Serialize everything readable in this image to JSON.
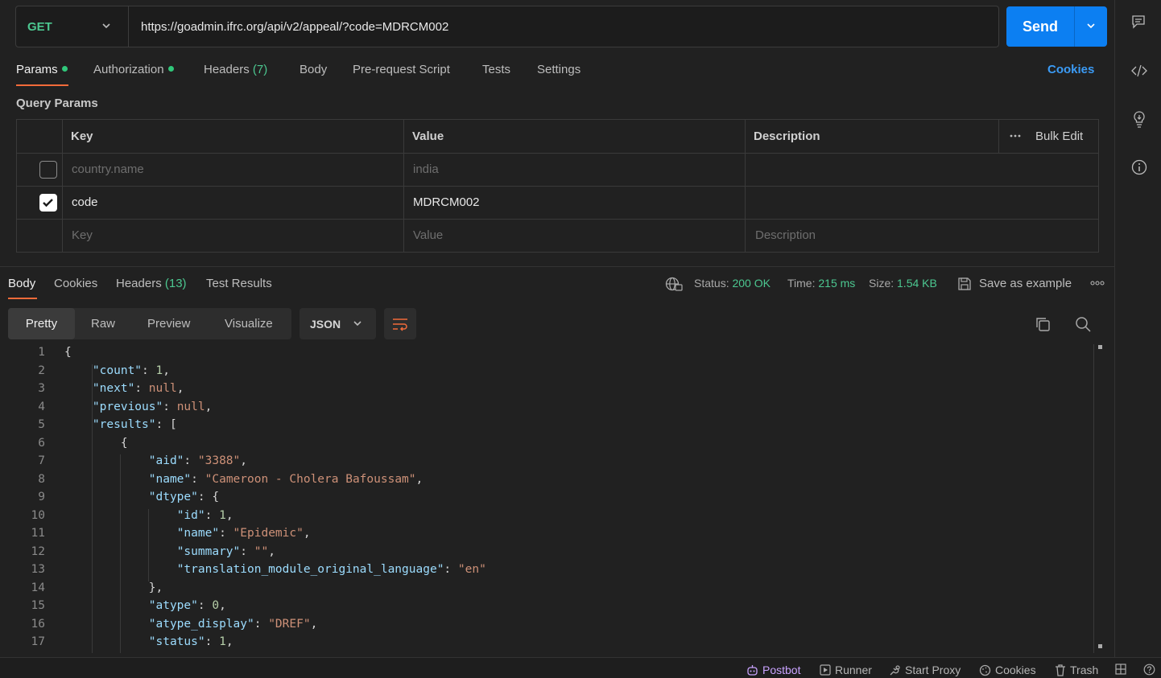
{
  "request": {
    "method": "GET",
    "url": "https://goadmin.ifrc.org/api/v2/appeal/?code=MDRCM002",
    "send_label": "Send"
  },
  "request_tabs": [
    {
      "label": "Params",
      "dot": true
    },
    {
      "label": "Authorization",
      "dot": true
    },
    {
      "label": "Headers",
      "count": "(7)"
    },
    {
      "label": "Body"
    },
    {
      "label": "Pre-request Script"
    },
    {
      "label": "Tests"
    },
    {
      "label": "Settings"
    }
  ],
  "cookies_link": "Cookies",
  "query_params": {
    "title": "Query Params",
    "headers": {
      "key": "Key",
      "value": "Value",
      "description": "Description",
      "bulk_edit": "Bulk Edit"
    },
    "rows": [
      {
        "checked": false,
        "key": "country.name",
        "value": "india",
        "description": ""
      },
      {
        "checked": true,
        "key": "code",
        "value": "MDRCM002",
        "description": ""
      }
    ],
    "placeholders": {
      "key": "Key",
      "value": "Value",
      "description": "Description"
    }
  },
  "response": {
    "tabs": [
      {
        "label": "Body"
      },
      {
        "label": "Cookies"
      },
      {
        "label": "Headers",
        "count": "(13)"
      },
      {
        "label": "Test Results"
      }
    ],
    "status_label": "Status:",
    "status_value": "200 OK",
    "time_label": "Time:",
    "time_value": "215 ms",
    "size_label": "Size:",
    "size_value": "1.54 KB",
    "save_example": "Save as example",
    "view_modes": [
      "Pretty",
      "Raw",
      "Preview",
      "Visualize"
    ],
    "format": "JSON"
  },
  "code_lines": [
    "{",
    "    \"count\": 1,",
    "    \"next\": null,",
    "    \"previous\": null,",
    "    \"results\": [",
    "        {",
    "            \"aid\": \"3388\",",
    "            \"name\": \"Cameroon - Cholera Bafoussam\",",
    "            \"dtype\": {",
    "                \"id\": 1,",
    "                \"name\": \"Epidemic\",",
    "                \"summary\": \"\",",
    "                \"translation_module_original_language\": \"en\"",
    "            },",
    "            \"atype\": 0,",
    "            \"atype_display\": \"DREF\",",
    "            \"status\": 1,"
  ],
  "footer": {
    "postbot": "Postbot",
    "runner": "Runner",
    "start_proxy": "Start Proxy",
    "cookies": "Cookies",
    "trash": "Trash"
  },
  "colors": {
    "accent_orange": "#f26b3a",
    "send_blue": "#0c7ff2",
    "method_green": "#4cc790",
    "json_key": "#9cdcfe",
    "json_string": "#ce9178"
  }
}
